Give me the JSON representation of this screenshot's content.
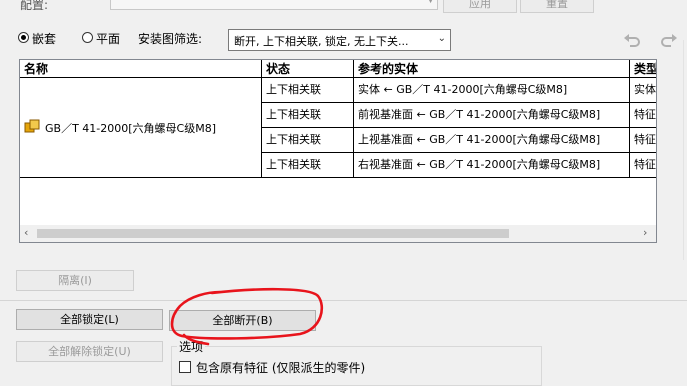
{
  "config": {
    "label": "配置:",
    "apply_label": "应用",
    "reset_label": "重置"
  },
  "view_mode": {
    "nested_label": "嵌套",
    "flat_label": "平面",
    "selected": "嵌套"
  },
  "filter": {
    "label": "安装图筛选:",
    "value": "断开, 上下相关联, 锁定, 无上下关..."
  },
  "table": {
    "columns": [
      "名称",
      "状态",
      "参考的实体",
      "类型"
    ],
    "component_name": "GB／T 41-2000[六角螺母C级M8]",
    "rows": [
      {
        "state": "上下相关联",
        "entity": "实体 ← GB／T 41-2000[六角螺母C级M8]",
        "type": "实体"
      },
      {
        "state": "上下相关联",
        "entity": "前视基准面 ← GB／T 41-2000[六角螺母C级M8]",
        "type": "特征"
      },
      {
        "state": "上下相关联",
        "entity": "上视基准面 ← GB／T 41-2000[六角螺母C级M8]",
        "type": "特征"
      },
      {
        "state": "上下相关联",
        "entity": "右视基准面 ← GB／T 41-2000[六角螺母C级M8]",
        "type": "特征"
      }
    ]
  },
  "buttons": {
    "isolate": "隔离(I)",
    "lock_all": "全部锁定(L)",
    "break_all": "全部断开(B)",
    "unlock_all": "全部解除锁定(U)"
  },
  "options": {
    "title": "选项",
    "include_original_label": "包含原有特征 (仅限派生的零件)",
    "include_original_checked": false
  },
  "colors": {
    "annotation_red": "#e8141c",
    "component_icon": "#e5a50a"
  }
}
